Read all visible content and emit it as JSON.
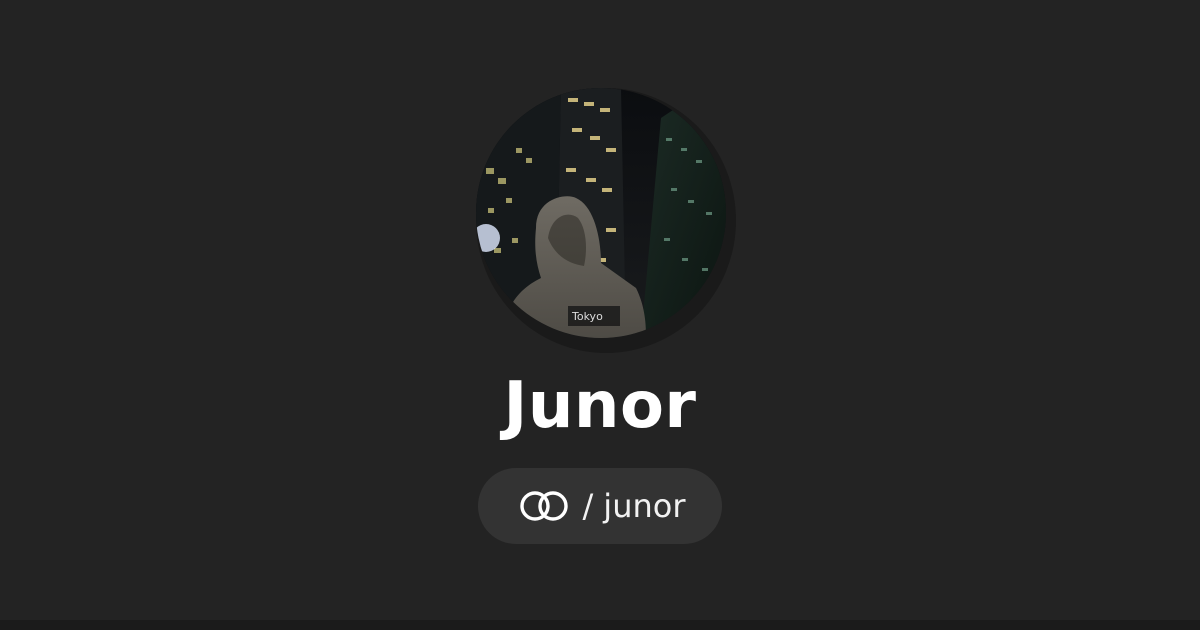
{
  "profile": {
    "display_name": "Junor",
    "handle_separator": "/",
    "handle": "junor",
    "avatar_description_icon": "profile-photo-icon",
    "logo_icon": "linked-rings-icon"
  },
  "colors": {
    "background": "#232323",
    "pill": "#333333",
    "text": "#ffffff"
  }
}
